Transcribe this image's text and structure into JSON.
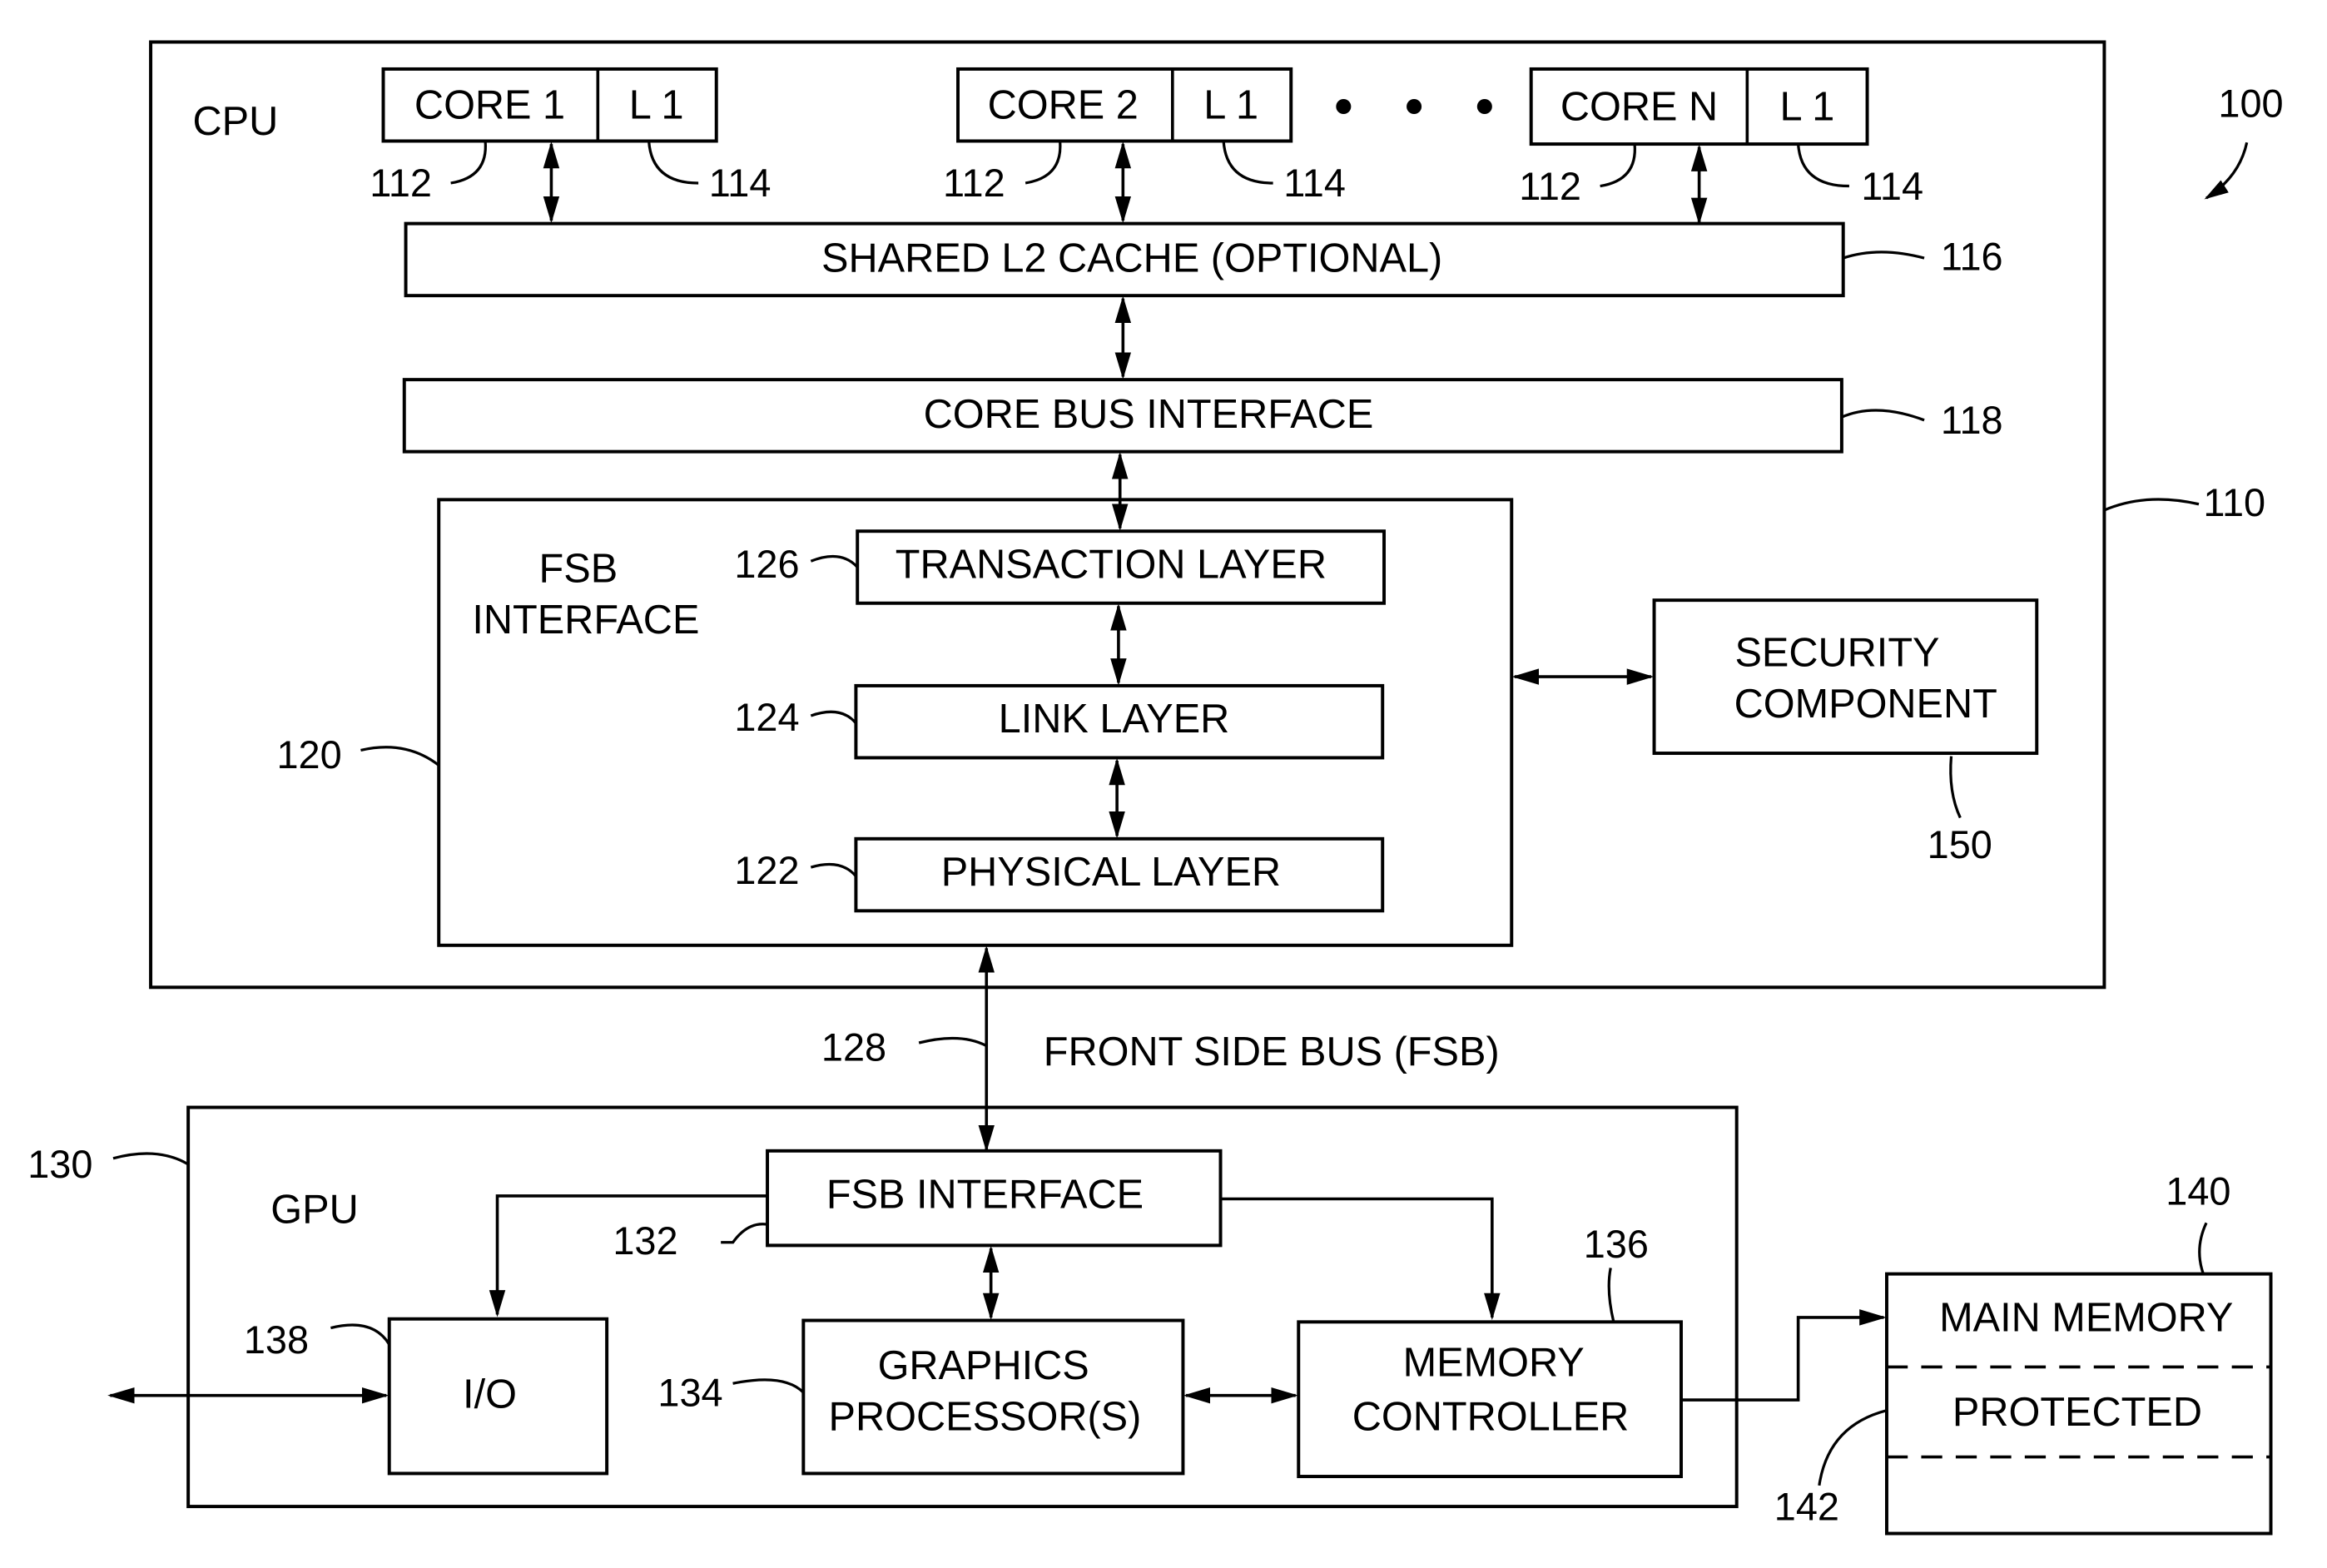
{
  "figure": {
    "ref": "100",
    "colors": {
      "ink": "#000000",
      "paper": "#ffffff"
    }
  },
  "cpu": {
    "label": "CPU",
    "ref": "110",
    "cores": [
      {
        "core_label": "CORE 1",
        "cache_label": "L 1",
        "core_ref": "112",
        "cache_ref": "114"
      },
      {
        "core_label": "CORE 2",
        "cache_label": "L 1",
        "core_ref": "112",
        "cache_ref": "114"
      },
      {
        "core_label": "CORE N",
        "cache_label": "L 1",
        "core_ref": "112",
        "cache_ref": "114"
      }
    ],
    "ellipsis": "• • •",
    "l2_cache": {
      "label": "SHARED L2 CACHE (OPTIONAL)",
      "ref": "116"
    },
    "core_bus": {
      "label": "CORE BUS INTERFACE",
      "ref": "118"
    },
    "fsb_interface": {
      "label_line1": "FSB",
      "label_line2": "INTERFACE",
      "ref": "120",
      "layers": [
        {
          "label": "TRANSACTION LAYER",
          "ref": "126"
        },
        {
          "label": "LINK LAYER",
          "ref": "124"
        },
        {
          "label": "PHYSICAL LAYER",
          "ref": "122"
        }
      ]
    },
    "security": {
      "label_line1": "SECURITY",
      "label_line2": "COMPONENT",
      "ref": "150"
    }
  },
  "bus": {
    "label": "FRONT SIDE BUS (FSB)",
    "ref": "128"
  },
  "gpu": {
    "label": "GPU",
    "ref": "130",
    "fsb_interface": {
      "label": "FSB INTERFACE",
      "ref": "132"
    },
    "graphics": {
      "label_line1": "GRAPHICS",
      "label_line2": "PROCESSOR(S)",
      "ref": "134"
    },
    "memory_controller": {
      "label_line1": "MEMORY",
      "label_line2": "CONTROLLER",
      "ref": "136"
    },
    "io": {
      "label": "I/O",
      "ref": "138"
    }
  },
  "main_memory": {
    "label": "MAIN MEMORY",
    "ref": "140",
    "protected": {
      "label": "PROTECTED",
      "ref": "142"
    }
  }
}
